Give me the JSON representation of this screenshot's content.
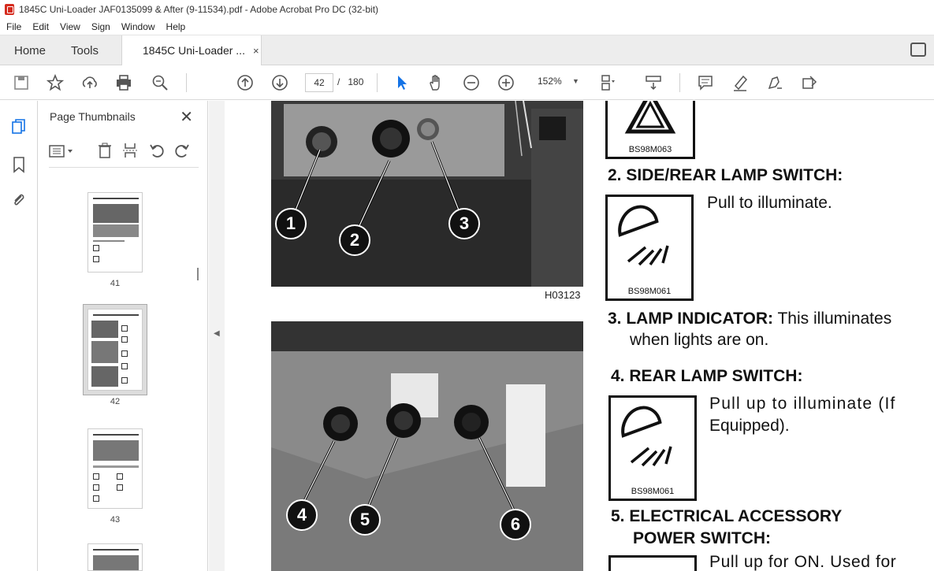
{
  "window": {
    "title": "1845C Uni-Loader JAF0135099 & After (9-11534).pdf - Adobe Acrobat Pro DC (32-bit)"
  },
  "menu": [
    "File",
    "Edit",
    "View",
    "Sign",
    "Window",
    "Help"
  ],
  "tabs": {
    "home": "Home",
    "tools": "Tools",
    "document": "1845C Uni-Loader ...",
    "close": "×"
  },
  "toolbar": {
    "current_page": "42",
    "page_sep": "/",
    "total_pages": "180",
    "zoom": "152%"
  },
  "panel": {
    "title": "Page Thumbnails",
    "close": "✕",
    "thumbnails": [
      "41",
      "42",
      "43"
    ]
  },
  "document": {
    "fig1_ref": "H03123",
    "callouts_top": [
      "1",
      "2",
      "3"
    ],
    "callouts_bottom": [
      "4",
      "5",
      "6"
    ],
    "icon_codes": [
      "BS98M063",
      "BS98M061",
      "BS98M061"
    ],
    "item2_heading": "2. SIDE/REAR LAMP SWITCH:",
    "item2_text": "Pull to illuminate.",
    "item3_heading": "3. LAMP INDICATOR:",
    "item3_text1": "This illuminates",
    "item3_text2": "when lights are on.",
    "item4_heading": "4. REAR LAMP SWITCH:",
    "item4_text1": "Pull up to illuminate (If",
    "item4_text2": "Equipped).",
    "item5_heading1": "5. ELECTRICAL ACCESSORY",
    "item5_heading2": "POWER SWITCH:",
    "item5_text": "Pull up for ON. Used for"
  },
  "colors": {
    "accent": "#1473e6",
    "pdf_red": "#d52b1e"
  }
}
